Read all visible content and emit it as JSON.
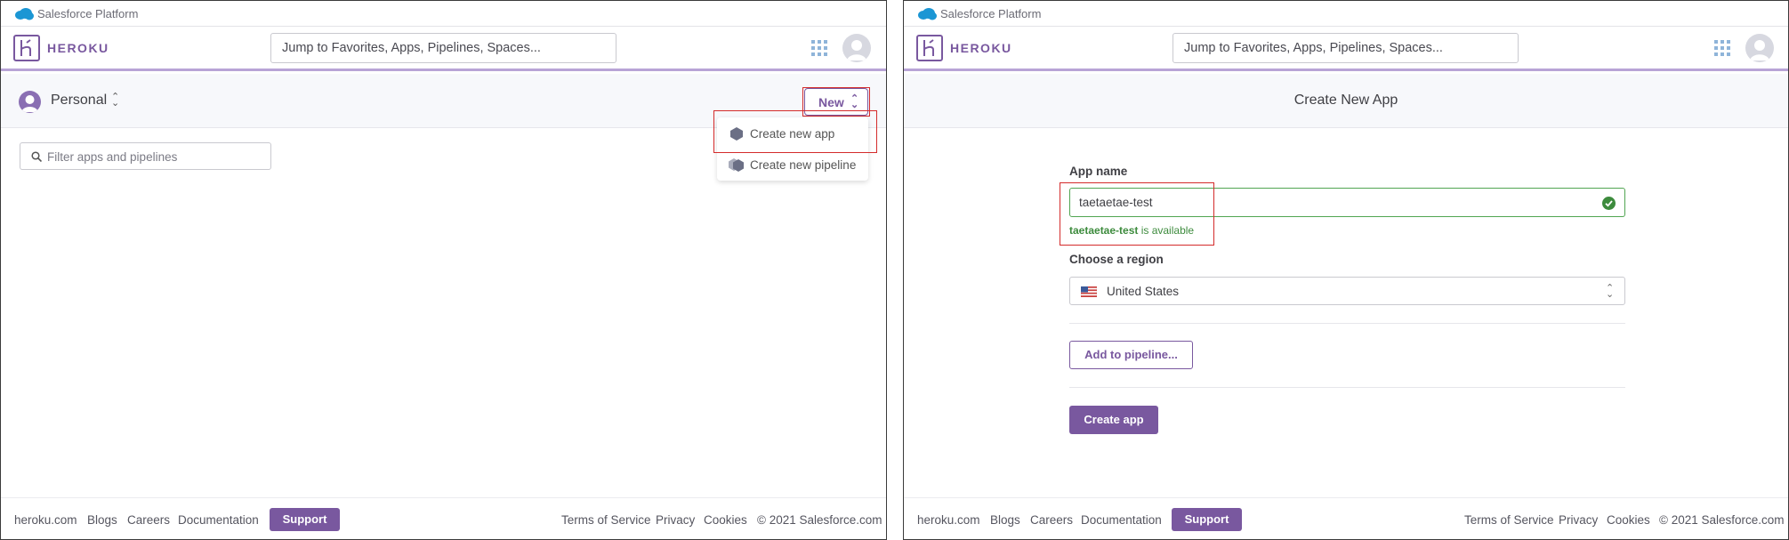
{
  "left": {
    "sf_bar": {
      "label": "Salesforce Platform"
    },
    "header": {
      "brand": "HEROKU",
      "search_placeholder": "Jump to Favorites, Apps, Pipelines, Spaces..."
    },
    "subheader": {
      "account_label": "Personal",
      "new_button": "New"
    },
    "new_menu": {
      "items": [
        {
          "label": "Create new app",
          "icon": "hexagon-icon"
        },
        {
          "label": "Create new pipeline",
          "icon": "pipeline-icon"
        }
      ]
    },
    "filter": {
      "placeholder": "Filter apps and pipelines"
    },
    "footer": {
      "links": [
        "heroku.com",
        "Blogs",
        "Careers",
        "Documentation"
      ],
      "support": "Support",
      "right_links": [
        "Terms of Service",
        "Privacy",
        "Cookies"
      ],
      "copyright": "© 2021 Salesforce.com"
    }
  },
  "right": {
    "sf_bar": {
      "label": "Salesforce Platform"
    },
    "header": {
      "brand": "HEROKU",
      "search_placeholder": "Jump to Favorites, Apps, Pipelines, Spaces..."
    },
    "page_title": "Create New App",
    "form": {
      "app_name_label": "App name",
      "app_name_value": "taetaetae-test",
      "availability_name": "taetaetae-test",
      "availability_suffix": " is available",
      "region_label": "Choose a region",
      "region_value": "United States",
      "add_pipeline": "Add to pipeline...",
      "create_button": "Create app"
    },
    "footer": {
      "links": [
        "heroku.com",
        "Blogs",
        "Careers",
        "Documentation"
      ],
      "support": "Support",
      "right_links": [
        "Terms of Service",
        "Privacy",
        "Cookies"
      ],
      "copyright": "© 2021 Salesforce.com"
    }
  },
  "colors": {
    "brand": "#79589f",
    "success": "#3d8b3d",
    "annotation": "#d42b2b"
  }
}
